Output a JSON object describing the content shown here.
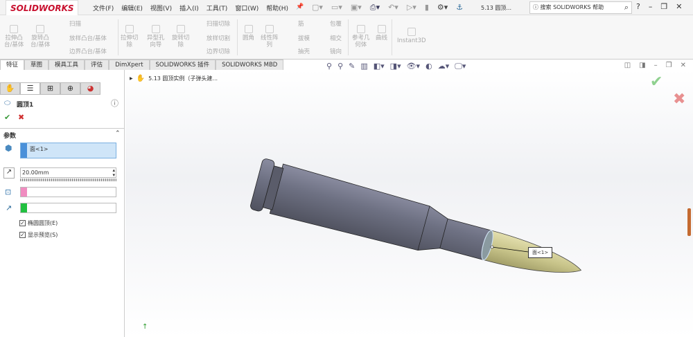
{
  "app": {
    "logo": "SOLIDWORKS",
    "doc_title": "5.13 圆顶...",
    "search_placeholder": "搜索 SOLIDWORKS 帮助"
  },
  "menu": [
    "文件(F)",
    "编辑(E)",
    "视图(V)",
    "插入(I)",
    "工具(T)",
    "窗口(W)",
    "帮助(H)"
  ],
  "ribbon": [
    {
      "label": "拉伸凸\n台/基体"
    },
    {
      "label": "旋转凸\n台/基体"
    },
    {
      "label": "扫描"
    },
    {
      "label": "放样凸台/基体"
    },
    {
      "label": "边界凸台/基体"
    },
    {
      "label": "拉伸切\n除"
    },
    {
      "label": "异型孔\n向导"
    },
    {
      "label": "旋转切\n除"
    },
    {
      "label": "扫描切除"
    },
    {
      "label": "放样切割"
    },
    {
      "label": "边界切除"
    },
    {
      "label": "圆角"
    },
    {
      "label": "线性阵\n列"
    },
    {
      "label": "筋"
    },
    {
      "label": "拔模"
    },
    {
      "label": "抽壳"
    },
    {
      "label": "包覆"
    },
    {
      "label": "相交"
    },
    {
      "label": "镜向"
    },
    {
      "label": "参考几\n何体"
    },
    {
      "label": "曲线"
    },
    {
      "label": "Instant3D"
    }
  ],
  "tabs": [
    "特征",
    "草图",
    "模具工具",
    "评估",
    "DimXpert",
    "SOLIDWORKS 插件",
    "SOLIDWORKS MBD"
  ],
  "panel": {
    "title": "圆顶1",
    "section": "参数",
    "face_value": "面<1>",
    "distance": "20.00mm",
    "check1": "椭圆圆顶(E)",
    "check2": "显示预览(S)"
  },
  "tree": {
    "root": "5.13 圆顶实例（子弹头建..."
  },
  "callout": "面<1>",
  "colors": {
    "accent": "#4a90d9",
    "body": "#6e7183",
    "bullet": "#c8c48a",
    "ok": "#3a9a3a",
    "cancel": "#d03030"
  }
}
